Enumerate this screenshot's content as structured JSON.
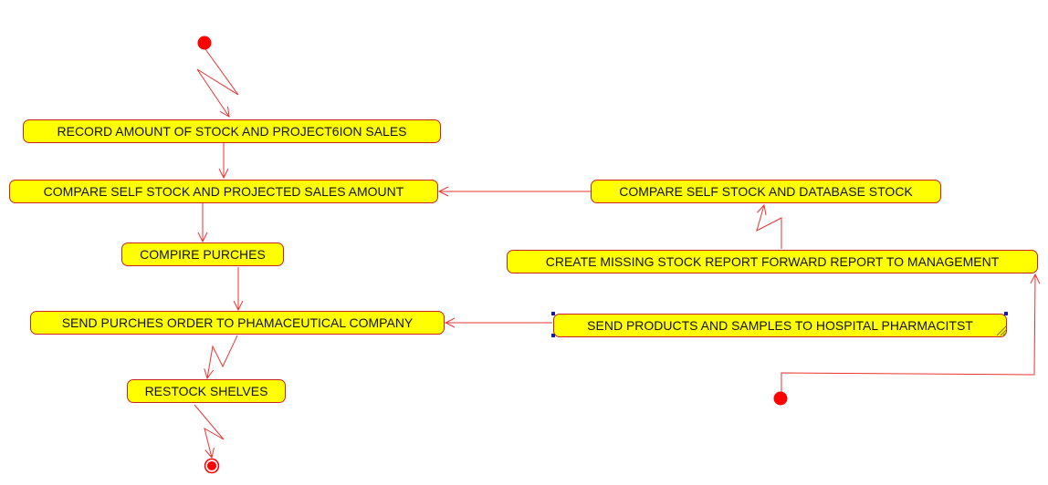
{
  "diagram": {
    "type": "activity",
    "colors": {
      "fill": "#ffff00",
      "stroke": "#cc2222",
      "connector": "#ee3333",
      "point": "#ff0000",
      "selection": "#1a1aa8"
    },
    "nodes": {
      "record": "RECORD AMOUNT OF STOCK AND PROJECT6ION SALES",
      "compare_self": "COMPARE SELF STOCK AND PROJECTED SALES AMOUNT",
      "compire": "COMPIRE PURCHES",
      "send_order": "SEND PURCHES ORDER TO PHAMACEUTICAL COMPANY",
      "restock": "RESTOCK SHELVES",
      "compare_db": "COMPARE SELF STOCK AND DATABASE STOCK",
      "missing_report": "CREATE MISSING STOCK REPORT FORWARD REPORT TO MANAGEMENT",
      "send_products": "SEND PRODUCTS AND SAMPLES TO HOSPITAL PHARMACITST"
    },
    "edges": [
      [
        "start-1",
        "record"
      ],
      [
        "record",
        "compare_self"
      ],
      [
        "compare_self",
        "compire"
      ],
      [
        "compire",
        "send_order"
      ],
      [
        "send_order",
        "restock"
      ],
      [
        "restock",
        "end"
      ],
      [
        "start-2",
        "missing_report"
      ],
      [
        "missing_report",
        "compare_db"
      ],
      [
        "compare_db",
        "compare_self"
      ],
      [
        "send_products",
        "send_order"
      ]
    ]
  }
}
